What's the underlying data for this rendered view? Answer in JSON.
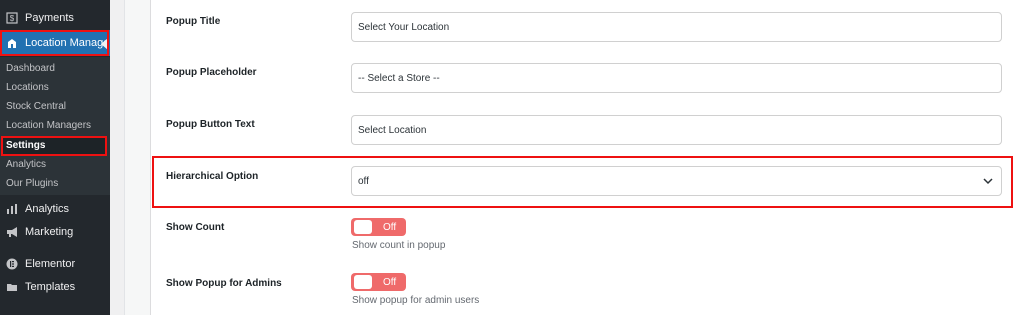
{
  "sidebar": {
    "payments_label": "Payments",
    "location_manage_label": "Location Manage",
    "submenu": {
      "dashboard": "Dashboard",
      "locations": "Locations",
      "stock_central": "Stock Central",
      "location_managers": "Location Managers",
      "settings": "Settings",
      "analytics": "Analytics",
      "our_plugins": "Our Plugins"
    },
    "analytics_label": "Analytics",
    "marketing_label": "Marketing",
    "elementor_label": "Elementor",
    "templates_label": "Templates"
  },
  "form": {
    "popup_title": {
      "label": "Popup Title",
      "value": "Select Your Location"
    },
    "popup_placeholder": {
      "label": "Popup Placeholder",
      "value": "-- Select a Store --"
    },
    "popup_button_text": {
      "label": "Popup Button Text",
      "value": "Select Location"
    },
    "hierarchical_option": {
      "label": "Hierarchical Option",
      "value": "off"
    },
    "show_count": {
      "label": "Show Count",
      "toggle": "Off",
      "help": "Show count in popup"
    },
    "show_popup_admins": {
      "label": "Show Popup for Admins",
      "toggle": "Off",
      "help": "Show popup for admin users"
    }
  },
  "colors": {
    "sidebar_bg": "#23282d",
    "active_bg": "#2271b1",
    "highlight_red": "#e11",
    "toggle_red": "#ef6a6a"
  }
}
